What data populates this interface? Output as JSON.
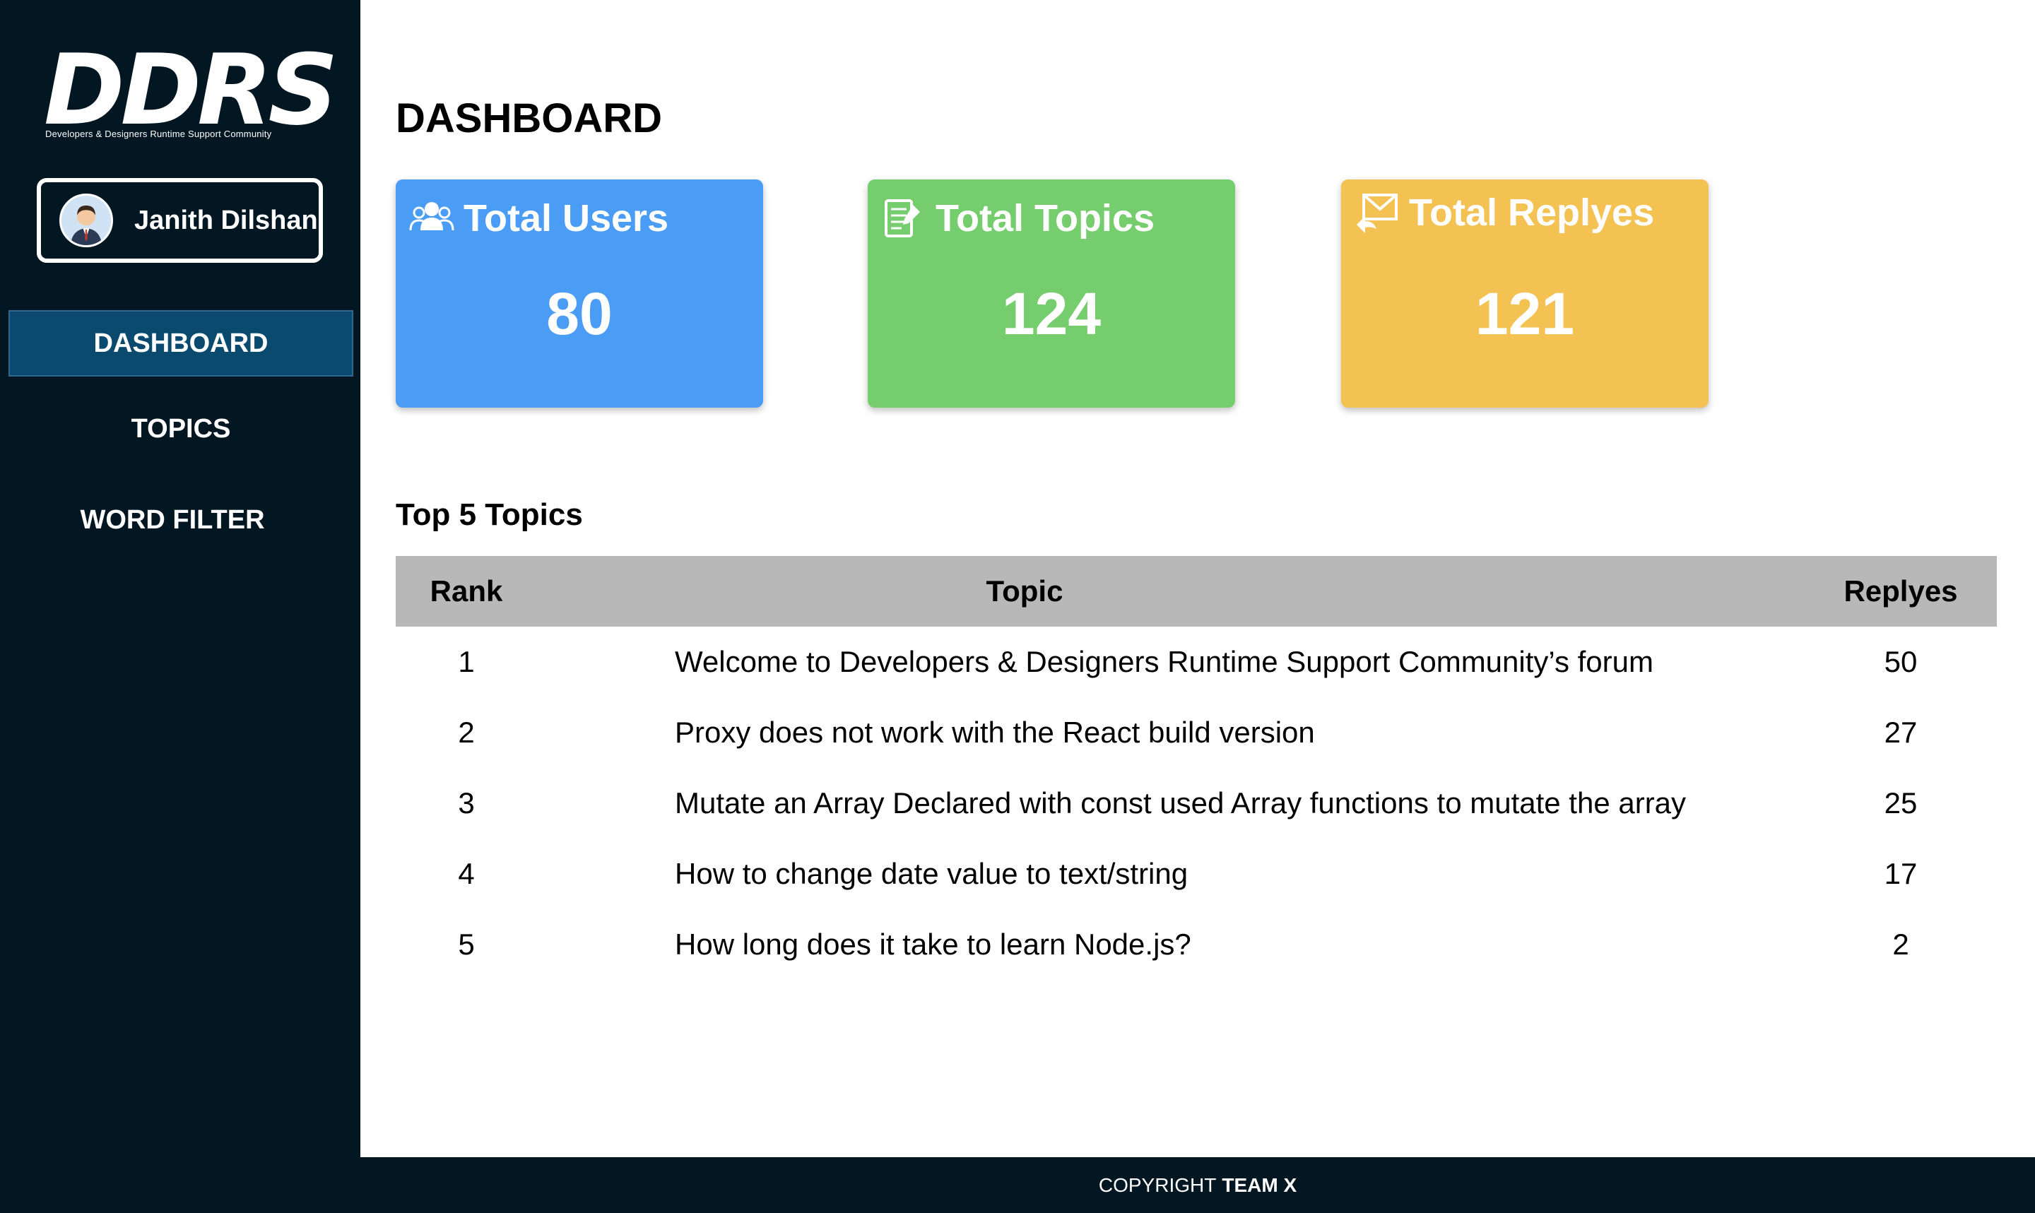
{
  "sidebar": {
    "logo_text": "DDRS",
    "logo_subtitle": "Developers & Designers Runtime Support Community",
    "user_name": "Janith Dilshan",
    "nav": [
      {
        "label": "DASHBOARD",
        "active": true
      },
      {
        "label": "TOPICS",
        "active": false
      },
      {
        "label": "WORD FILTER",
        "active": false
      }
    ]
  },
  "main": {
    "title": "DASHBOARD",
    "cards": [
      {
        "label": "Total Users",
        "value": "80",
        "color": "#4a9cf5",
        "icon": "users-icon"
      },
      {
        "label": "Total Topics",
        "value": "124",
        "color": "#76cd6e",
        "icon": "document-icon"
      },
      {
        "label": "Total Replyes",
        "value": "121",
        "color": "#f4c153",
        "icon": "mail-reply-icon"
      }
    ],
    "top_topics": {
      "title": "Top 5 Topics",
      "headers": {
        "rank": "Rank",
        "topic": "Topic",
        "replies": "Replyes"
      },
      "rows": [
        {
          "rank": "1",
          "topic": "Welcome to Developers & Designers Runtime Support Community’s forum",
          "replies": "50"
        },
        {
          "rank": "2",
          "topic": "Proxy does not work with the React build version",
          "replies": "27"
        },
        {
          "rank": "3",
          "topic": "Mutate an Array Declared with const used Array functions to mutate the array",
          "replies": "25"
        },
        {
          "rank": "4",
          "topic": "How to change date value to text/string",
          "replies": "17"
        },
        {
          "rank": "5",
          "topic": "How long does it take to learn Node.js?",
          "replies": "2"
        }
      ]
    }
  },
  "footer": {
    "prefix": "COPYRIGHT",
    "team": "TEAM X"
  }
}
